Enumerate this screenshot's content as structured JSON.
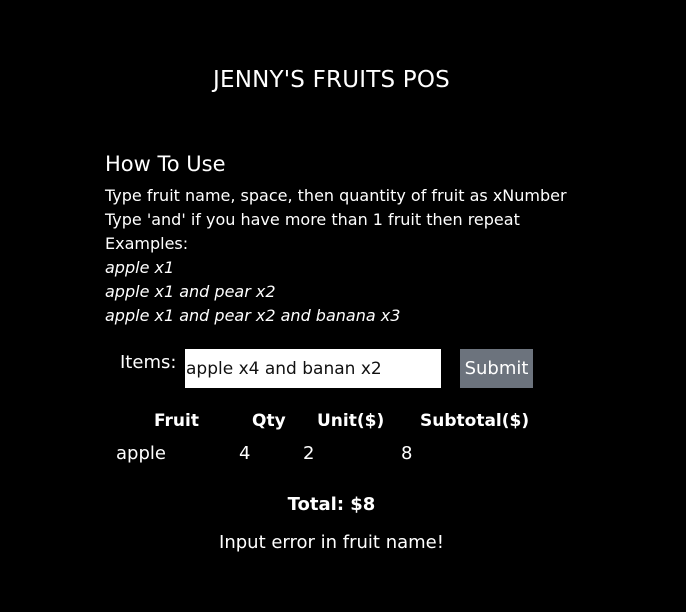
{
  "app": {
    "title": "JENNY'S FRUITS POS"
  },
  "how_to": {
    "heading": "How To Use",
    "lines": [
      "Type fruit name, space, then quantity of fruit as xNumber",
      "Type 'and' if you have more than 1 fruit then repeat",
      "Examples:"
    ],
    "examples": [
      "apple x1",
      "apple x1 and pear x2",
      "apple x1 and pear x2 and banana x3"
    ]
  },
  "form": {
    "items_label": "Items:",
    "items_value": "apple x4 and banan x2",
    "submit_label": "Submit"
  },
  "table": {
    "headers": [
      "Fruit",
      "Qty",
      "Unit($)",
      "Subtotal($)"
    ],
    "rows": [
      [
        "apple",
        "4",
        "2",
        "8"
      ]
    ]
  },
  "total": {
    "text": "Total: $8"
  },
  "message": {
    "error": "Input error in fruit name!"
  },
  "colors": {
    "background": "#000000",
    "text": "#ffffff",
    "submit_button": "#6c737d"
  }
}
